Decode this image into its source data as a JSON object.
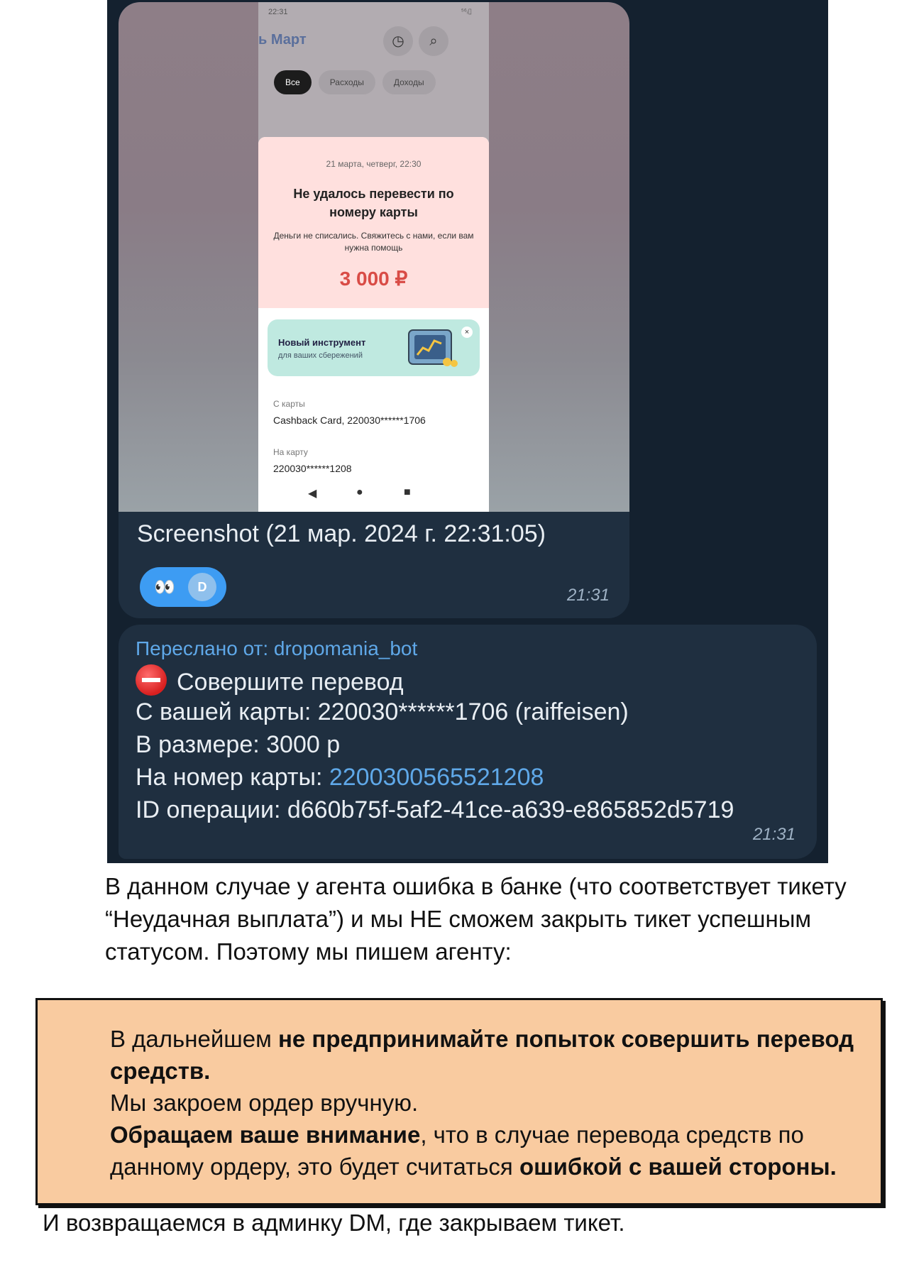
{
  "phone": {
    "status_time": "22:31",
    "status_icons": "⁵⁶ᵢ▯",
    "title": "ь Март",
    "chips": [
      "Все",
      "Расходы",
      "Доходы"
    ],
    "sheet": {
      "date": "21 марта, четверг, 22:30",
      "title": "Не удалось перевести по номеру карты",
      "subtitle": "Деньги не списались. Свяжитесь с нами, если вам нужна помощь",
      "amount": "3 000 ₽",
      "promo_title": "Новый инструмент",
      "promo_sub": "для ваших сбережений",
      "from_label": "С карты",
      "from_value": "Cashback Card, 220030******1706",
      "to_label": "На карту",
      "to_value": "220030******1208"
    }
  },
  "photo_message": {
    "caption": "Screenshot (21 мар. 2024 г. 22:31:05)",
    "reaction_emoji": "👀",
    "reaction_avatar": "D",
    "time": "21:31"
  },
  "text_message": {
    "forwarded": "Переслано от: dropomania_bot",
    "line1": "Совершите перевод",
    "line2": "С вашей карты: 220030******1706 (raiffeisen)",
    "line3": "В размере: 3000 р",
    "line4_prefix": "На номер карты: ",
    "line4_link": "2200300565521208",
    "line5": "ID операции: d660b75f-5af2-41ce-a639-e865852d5719",
    "time": "21:31"
  },
  "document": {
    "paragraph": "В данном случае у агента ошибка в банке (что соответствует тикету “Неудачная выплата”) и мы НЕ сможем закрыть тикет успешным статусом. Поэтому мы пишем агенту:",
    "notice": {
      "p1_normal": "В дальнейшем ",
      "p1_bold": "не предпринимайте попыток совершить перевод средств.",
      "p2": "Мы закроем ордер вручную.",
      "p3_bold": "Обращаем ваше внимание",
      "p3_normal": ", что в случае перевода средств по данному ордеру, это будет считаться ",
      "p3_bold2": "ошибкой с вашей стороны."
    },
    "closing": "И возвращаемся в админку DM, где закрываем тикет."
  },
  "colors": {
    "chat_bg": "#14212f",
    "bubble": "#1f2f40",
    "link": "#5fa8e8",
    "reaction": "#3d9cf3",
    "notice_bg": "#f9cba0",
    "amount_red": "#d94c46"
  }
}
